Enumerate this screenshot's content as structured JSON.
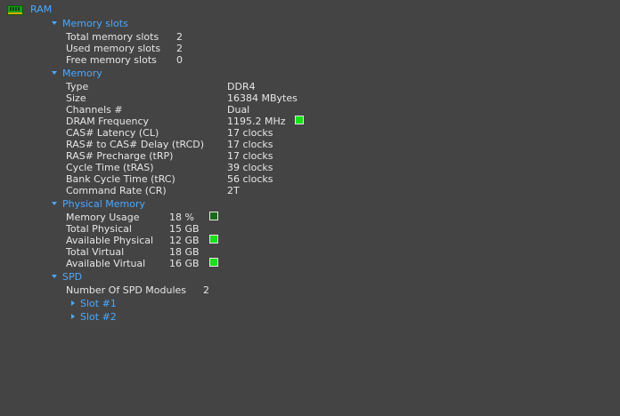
{
  "root": {
    "label": "RAM",
    "icon": "ram-module-icon"
  },
  "memory_slots": {
    "title": "Memory slots",
    "rows": [
      {
        "label": "Total memory slots",
        "value": "2"
      },
      {
        "label": "Used memory slots",
        "value": "2"
      },
      {
        "label": "Free memory slots",
        "value": "0"
      }
    ]
  },
  "memory": {
    "title": "Memory",
    "rows": [
      {
        "label": "Type",
        "value": "DDR4"
      },
      {
        "label": "Size",
        "value": "16384 MBytes"
      },
      {
        "label": "Channels #",
        "value": "Dual"
      },
      {
        "label": "DRAM Frequency",
        "value": "1195.2 MHz"
      },
      {
        "label": "CAS# Latency (CL)",
        "value": "17 clocks"
      },
      {
        "label": "RAS# to CAS# Delay (tRCD)",
        "value": "17 clocks"
      },
      {
        "label": "RAS# Precharge (tRP)",
        "value": "17 clocks"
      },
      {
        "label": "Cycle Time (tRAS)",
        "value": "39 clocks"
      },
      {
        "label": "Bank Cycle Time (tRC)",
        "value": "56 clocks"
      },
      {
        "label": "Command Rate (CR)",
        "value": "2T"
      }
    ]
  },
  "physical_memory": {
    "title": "Physical Memory",
    "rows": [
      {
        "label": "Memory Usage",
        "value": "18 %"
      },
      {
        "label": "Total Physical",
        "value": "15 GB"
      },
      {
        "label": "Available Physical",
        "value": "12 GB"
      },
      {
        "label": "Total Virtual",
        "value": "18 GB"
      },
      {
        "label": "Available Virtual",
        "value": "16 GB"
      }
    ]
  },
  "spd": {
    "title": "SPD",
    "rows": [
      {
        "label": "Number Of SPD Modules",
        "value": "2"
      }
    ],
    "slots": [
      {
        "label": "Slot #1"
      },
      {
        "label": "Slot #2"
      }
    ]
  },
  "colors": {
    "background": "#444444",
    "text": "#e6e6e6",
    "header": "#4aa8ff",
    "indicator_green": "#18e018"
  }
}
